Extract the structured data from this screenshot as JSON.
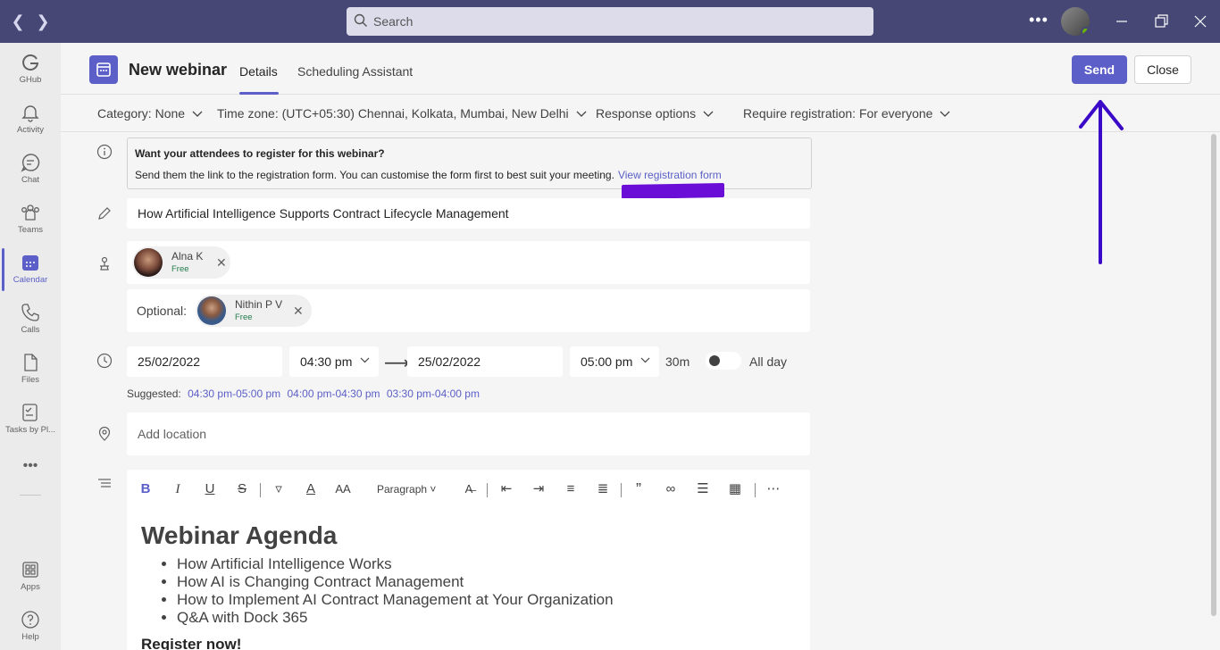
{
  "titlebar": {
    "search_placeholder": "Search",
    "more_label": "•••"
  },
  "rail": {
    "items": [
      {
        "label": "GHub",
        "icon": "ghub-icon"
      },
      {
        "label": "Activity",
        "icon": "bell-icon"
      },
      {
        "label": "Chat",
        "icon": "chat-icon"
      },
      {
        "label": "Teams",
        "icon": "teams-icon"
      },
      {
        "label": "Calendar",
        "icon": "calendar-icon"
      },
      {
        "label": "Calls",
        "icon": "phone-icon"
      },
      {
        "label": "Files",
        "icon": "file-icon"
      },
      {
        "label": "Tasks by Pl...",
        "icon": "tasks-icon"
      },
      {
        "label": "Apps",
        "icon": "apps-icon"
      },
      {
        "label": "Help",
        "icon": "help-icon"
      }
    ],
    "more_label": "•••",
    "active_color": "#5b5fc7"
  },
  "header": {
    "title": "New webinar",
    "tabs": [
      "Details",
      "Scheduling Assistant"
    ],
    "send_label": "Send",
    "close_label": "Close"
  },
  "options": {
    "category": "Category: None",
    "timezone": "Time zone: (UTC+05:30) Chennai, Kolkata, Mumbai, New Delhi",
    "response": "Response options",
    "registration": "Require registration: For everyone"
  },
  "info": {
    "title": "Want your attendees to register for this webinar?",
    "text": "Send them the link to the registration form. You can customise the form first to best suit your meeting.",
    "link": "View registration form"
  },
  "form": {
    "title_value": "How Artificial Intelligence Supports Contract Lifecycle Management",
    "presenter": {
      "name": "Alna K",
      "status": "Free"
    },
    "optional_label": "Optional:",
    "optional_attendee": {
      "name": "Nithin P V",
      "status": "Free"
    },
    "start_date": "25/02/2022",
    "start_time": "04:30 pm",
    "end_date": "25/02/2022",
    "end_time": "05:00 pm",
    "duration": "30m",
    "all_day_label": "All day",
    "suggested_label": "Suggested:",
    "suggested": [
      "04:30 pm-05:00 pm",
      "04:00 pm-04:30 pm",
      "03:30 pm-04:00 pm"
    ],
    "location_placeholder": "Add location"
  },
  "editor": {
    "paragraph_label": "Paragraph",
    "heading": "Webinar Agenda",
    "items": [
      "How Artificial Intelligence Works",
      "How AI is Changing Contract Management",
      "How to Implement AI Contract Management at Your Organization",
      "Q&A with Dock 365"
    ],
    "footer": "Register now!"
  }
}
